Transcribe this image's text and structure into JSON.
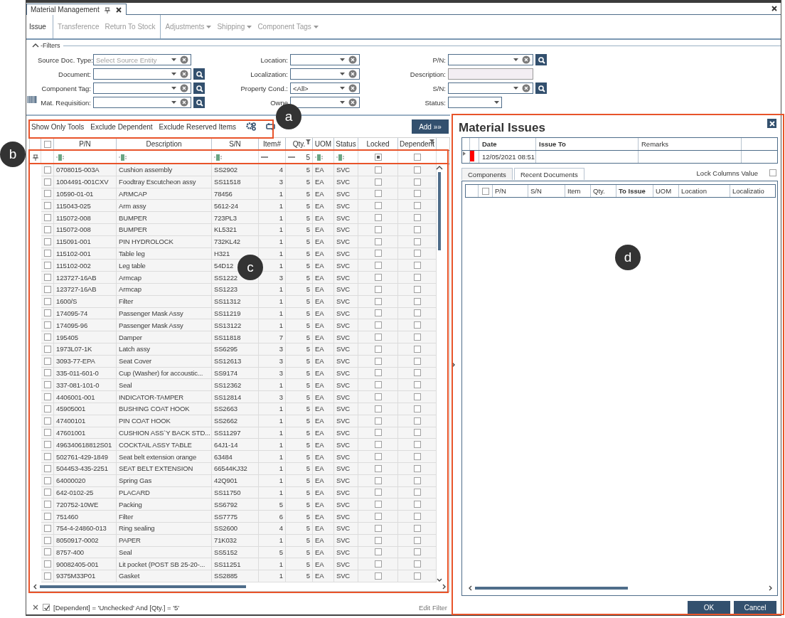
{
  "window": {
    "tab": "Material Management"
  },
  "toolbar": [
    {
      "label": "Issue",
      "selected": true,
      "menu": false,
      "group_start": false
    },
    {
      "label": "Transference",
      "selected": false,
      "menu": false,
      "group_start": true
    },
    {
      "label": "Return To Stock",
      "selected": false,
      "menu": false,
      "group_start": false
    },
    {
      "label": "Adjustments",
      "selected": false,
      "menu": true,
      "group_start": true
    },
    {
      "label": "Shipping",
      "selected": false,
      "menu": true,
      "group_start": false
    },
    {
      "label": "Component Tags",
      "selected": false,
      "menu": true,
      "group_start": false
    }
  ],
  "filters": {
    "title": "-Filters",
    "expanded": true,
    "columns": [
      [
        {
          "label": "Source Doc. Type:",
          "kind": "combo",
          "placeholder": "Select Source Entity",
          "search": false
        },
        {
          "label": "Document:",
          "kind": "combo",
          "search": true
        },
        {
          "label": "Component Tag:",
          "kind": "combo",
          "search": true
        },
        {
          "label": "Mat. Requisition:",
          "kind": "combo",
          "search": true
        }
      ],
      [
        {
          "label": "Location:",
          "kind": "combo",
          "search": false
        },
        {
          "label": "Localization:",
          "kind": "combo",
          "search": false
        },
        {
          "label": "Property Cond.:",
          "kind": "combo",
          "value": "<All>",
          "search": false
        },
        {
          "label": "Owne",
          "kind": "combo",
          "search": false
        }
      ],
      [
        {
          "label": "P/N:",
          "kind": "combo",
          "search": true
        },
        {
          "label": "Description:",
          "kind": "text",
          "search": false
        },
        {
          "label": "S/N:",
          "kind": "combo",
          "search": true
        },
        {
          "label": "Status:",
          "kind": "select",
          "search": false
        }
      ]
    ]
  },
  "grid_toolbar": {
    "actions": [
      "Show Only Tools",
      "Exclude Dependent",
      "Exclude Reserved Items"
    ],
    "add_button": "Add »»"
  },
  "table": {
    "select_all": false,
    "columns": [
      {
        "label": "P/N",
        "filter": {
          "kind": "text"
        },
        "filtered": false
      },
      {
        "label": "Description",
        "filter": {
          "kind": "text"
        },
        "filtered": false
      },
      {
        "label": "S/N",
        "filter": {
          "kind": "text"
        },
        "filtered": false
      },
      {
        "label": "Item#",
        "filter": {
          "kind": "equals"
        },
        "filtered": false
      },
      {
        "label": "Qty.",
        "filter": {
          "kind": "equals",
          "value": "5"
        },
        "filtered": true
      },
      {
        "label": "UOM",
        "filter": {
          "kind": "text"
        },
        "filtered": false
      },
      {
        "label": "Status",
        "filter": {
          "kind": "text"
        },
        "filtered": false
      },
      {
        "label": "Locked",
        "filter": {
          "kind": "check",
          "checked": true
        },
        "filtered": false
      },
      {
        "label": "Dependent",
        "filter": {
          "kind": "check",
          "checked": false
        },
        "filtered": true
      }
    ],
    "rows": [
      {
        "pn": "0708015-003A",
        "description": "Cushion assembly",
        "sn": "SS2902",
        "item": "4",
        "qty": "5",
        "uom": "EA",
        "status": "SVC",
        "checked": false,
        "locked": false,
        "dependent": false
      },
      {
        "pn": "1004491-001CXV",
        "description": "Foodtray Escutcheon assy",
        "sn": "SS11518",
        "item": "3",
        "qty": "5",
        "uom": "EA",
        "status": "SVC",
        "checked": false,
        "locked": false,
        "dependent": false
      },
      {
        "pn": "10590-01-01",
        "description": "ARMCAP",
        "sn": "78456",
        "item": "1",
        "qty": "5",
        "uom": "EA",
        "status": "SVC",
        "checked": false,
        "locked": false,
        "dependent": false
      },
      {
        "pn": "115043-025",
        "description": "Arm assy",
        "sn": "5612-24",
        "item": "1",
        "qty": "5",
        "uom": "EA",
        "status": "SVC",
        "checked": false,
        "locked": false,
        "dependent": false
      },
      {
        "pn": "115072-008",
        "description": "BUMPER",
        "sn": "723PL3",
        "item": "1",
        "qty": "5",
        "uom": "EA",
        "status": "SVC",
        "checked": false,
        "locked": false,
        "dependent": false
      },
      {
        "pn": "115072-008",
        "description": "BUMPER",
        "sn": "KL5321",
        "item": "1",
        "qty": "5",
        "uom": "EA",
        "status": "SVC",
        "checked": false,
        "locked": false,
        "dependent": false
      },
      {
        "pn": "115091-001",
        "description": "PIN HYDROLOCK",
        "sn": "732KL42",
        "item": "1",
        "qty": "5",
        "uom": "EA",
        "status": "SVC",
        "checked": false,
        "locked": false,
        "dependent": false
      },
      {
        "pn": "115102-001",
        "description": "Table leg",
        "sn": "H321",
        "item": "1",
        "qty": "5",
        "uom": "EA",
        "status": "SVC",
        "checked": false,
        "locked": false,
        "dependent": false
      },
      {
        "pn": "115102-002",
        "description": "Leg table",
        "sn": "54D12",
        "item": "1",
        "qty": "5",
        "uom": "EA",
        "status": "SVC",
        "checked": false,
        "locked": false,
        "dependent": false
      },
      {
        "pn": "123727-16AB",
        "description": "Armcap",
        "sn": "SS1222",
        "item": "3",
        "qty": "5",
        "uom": "EA",
        "status": "SVC",
        "checked": false,
        "locked": false,
        "dependent": false
      },
      {
        "pn": "123727-16AB",
        "description": "Armcap",
        "sn": "SS1223",
        "item": "1",
        "qty": "5",
        "uom": "EA",
        "status": "SVC",
        "checked": false,
        "locked": false,
        "dependent": false
      },
      {
        "pn": "1600/S",
        "description": "Filter",
        "sn": "SS11312",
        "item": "1",
        "qty": "5",
        "uom": "EA",
        "status": "SVC",
        "checked": false,
        "locked": false,
        "dependent": false
      },
      {
        "pn": "174095-74",
        "description": "Passenger Mask Assy",
        "sn": "SS11219",
        "item": "1",
        "qty": "5",
        "uom": "EA",
        "status": "SVC",
        "checked": false,
        "locked": false,
        "dependent": false
      },
      {
        "pn": "174095-96",
        "description": "Passenger Mask Assy",
        "sn": "SS13122",
        "item": "1",
        "qty": "5",
        "uom": "EA",
        "status": "SVC",
        "checked": false,
        "locked": false,
        "dependent": false
      },
      {
        "pn": "195405",
        "description": "Damper",
        "sn": "SS11818",
        "item": "7",
        "qty": "5",
        "uom": "EA",
        "status": "SVC",
        "checked": false,
        "locked": false,
        "dependent": false
      },
      {
        "pn": "1973L07-1K",
        "description": "Latch assy",
        "sn": "SS6295",
        "item": "3",
        "qty": "5",
        "uom": "EA",
        "status": "SVC",
        "checked": false,
        "locked": false,
        "dependent": false
      },
      {
        "pn": "3093-77-EPA",
        "description": "Seat Cover",
        "sn": "SS12613",
        "item": "3",
        "qty": "5",
        "uom": "EA",
        "status": "SVC",
        "checked": false,
        "locked": false,
        "dependent": false
      },
      {
        "pn": "335-011-601-0",
        "description": "Cup (Washer) for accoustic...",
        "sn": "SS9174",
        "item": "3",
        "qty": "5",
        "uom": "EA",
        "status": "SVC",
        "checked": false,
        "locked": false,
        "dependent": false
      },
      {
        "pn": "337-081-101-0",
        "description": "Seal",
        "sn": "SS12362",
        "item": "1",
        "qty": "5",
        "uom": "EA",
        "status": "SVC",
        "checked": false,
        "locked": false,
        "dependent": false
      },
      {
        "pn": "4406001-001",
        "description": "INDICATOR-TAMPER",
        "sn": "SS12814",
        "item": "3",
        "qty": "5",
        "uom": "EA",
        "status": "SVC",
        "checked": false,
        "locked": false,
        "dependent": false
      },
      {
        "pn": "45905001",
        "description": "BUSHING COAT HOOK",
        "sn": "SS2663",
        "item": "1",
        "qty": "5",
        "uom": "EA",
        "status": "SVC",
        "checked": false,
        "locked": false,
        "dependent": false
      },
      {
        "pn": "47400101",
        "description": "PIN COAT HOOK",
        "sn": "SS2662",
        "item": "1",
        "qty": "5",
        "uom": "EA",
        "status": "SVC",
        "checked": false,
        "locked": false,
        "dependent": false
      },
      {
        "pn": "47601001",
        "description": "CUSHION ASS`Y BACK STD...",
        "sn": "SS11297",
        "item": "1",
        "qty": "5",
        "uom": "EA",
        "status": "SVC",
        "checked": false,
        "locked": false,
        "dependent": false
      },
      {
        "pn": "496340618812S01",
        "description": "COCKTAIL ASSY TABLE",
        "sn": "64J1-14",
        "item": "1",
        "qty": "5",
        "uom": "EA",
        "status": "SVC",
        "checked": false,
        "locked": false,
        "dependent": false
      },
      {
        "pn": "502761-429-1849",
        "description": "Seat belt extension orange",
        "sn": "63484",
        "item": "1",
        "qty": "5",
        "uom": "EA",
        "status": "SVC",
        "checked": false,
        "locked": false,
        "dependent": false
      },
      {
        "pn": "504453-435-2251",
        "description": "SEAT BELT EXTENSION",
        "sn": "66544KJ32",
        "item": "1",
        "qty": "5",
        "uom": "EA",
        "status": "SVC",
        "checked": false,
        "locked": false,
        "dependent": false
      },
      {
        "pn": "64000020",
        "description": "Spring Gas",
        "sn": "42Q901",
        "item": "1",
        "qty": "5",
        "uom": "EA",
        "status": "SVC",
        "checked": false,
        "locked": false,
        "dependent": false
      },
      {
        "pn": "642-0102-25",
        "description": "PLACARD",
        "sn": "SS11750",
        "item": "1",
        "qty": "5",
        "uom": "EA",
        "status": "SVC",
        "checked": false,
        "locked": false,
        "dependent": false
      },
      {
        "pn": "720752-10WE",
        "description": "Packing",
        "sn": "SS6792",
        "item": "5",
        "qty": "5",
        "uom": "EA",
        "status": "SVC",
        "checked": false,
        "locked": false,
        "dependent": false
      },
      {
        "pn": "751460",
        "description": "Filter",
        "sn": "SS7775",
        "item": "6",
        "qty": "5",
        "uom": "EA",
        "status": "SVC",
        "checked": false,
        "locked": false,
        "dependent": false
      },
      {
        "pn": "754-4-24860-013",
        "description": "Ring sealing",
        "sn": "SS2600",
        "item": "4",
        "qty": "5",
        "uom": "EA",
        "status": "SVC",
        "checked": false,
        "locked": false,
        "dependent": false
      },
      {
        "pn": "8050917-0002",
        "description": "PAPER",
        "sn": "71K032",
        "item": "1",
        "qty": "5",
        "uom": "EA",
        "status": "SVC",
        "checked": false,
        "locked": false,
        "dependent": false
      },
      {
        "pn": "8757-400",
        "description": "Seal",
        "sn": "SS5152",
        "item": "5",
        "qty": "5",
        "uom": "EA",
        "status": "SVC",
        "checked": false,
        "locked": false,
        "dependent": false
      },
      {
        "pn": "90082405-001",
        "description": "Lit pocket (POST SB 25-20-...",
        "sn": "SS11251",
        "item": "1",
        "qty": "5",
        "uom": "EA",
        "status": "SVC",
        "checked": false,
        "locked": false,
        "dependent": false
      },
      {
        "pn": "9375M33P01",
        "description": "Gasket",
        "sn": "SS2885",
        "item": "1",
        "qty": "5",
        "uom": "EA",
        "status": "SVC",
        "checked": false,
        "locked": false,
        "dependent": false
      }
    ]
  },
  "filter_bar": {
    "enabled": true,
    "expression": "[Dependent] = 'Unchecked' And [Qty.] = '5'",
    "edit_link": "Edit Filter"
  },
  "issues_panel": {
    "title": "Material Issues",
    "columns": [
      {
        "label": "Date",
        "bold": true
      },
      {
        "label": "Issue To",
        "bold": true
      },
      {
        "label": "Remarks",
        "bold": false
      }
    ],
    "rows": [
      {
        "date": "12/05/2021 08:51",
        "color": "#ff0000"
      }
    ],
    "tabs": [
      {
        "label": "Components",
        "selected": true
      },
      {
        "label": "Recent Documents",
        "selected": false
      }
    ],
    "lock_columns": {
      "label": "Lock Columns Value",
      "checked": false
    },
    "components": {
      "select_all": false,
      "columns": [
        {
          "label": "P/N",
          "bold": false
        },
        {
          "label": "S/N",
          "bold": false
        },
        {
          "label": "Item",
          "bold": false
        },
        {
          "label": "Qty.",
          "bold": false
        },
        {
          "label": "To Issue",
          "bold": true
        },
        {
          "label": "UOM",
          "bold": false
        },
        {
          "label": "Location",
          "bold": false
        },
        {
          "label": "Localizatio",
          "bold": false
        }
      ]
    },
    "buttons": [
      "OK",
      "Cancel"
    ]
  },
  "annotations": [
    {
      "label": "a"
    },
    {
      "label": "b"
    },
    {
      "label": "c"
    },
    {
      "label": "d"
    }
  ]
}
